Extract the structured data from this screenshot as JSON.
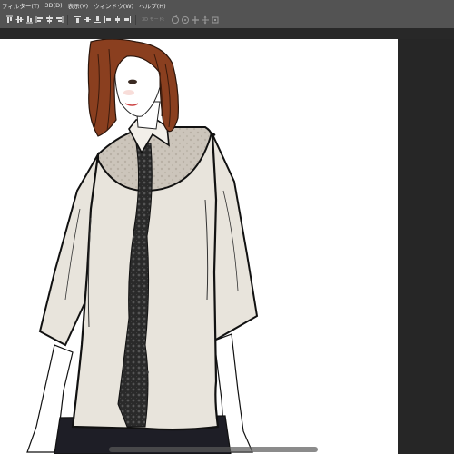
{
  "menu": [
    "フィルター(T)",
    "3D(D)",
    "表示(V)",
    "ウィンドウ(W)",
    "ヘルプ(H)"
  ],
  "options_bar": {
    "mode_3d_label": "3D モード:",
    "align_icons": [
      "align-top-edges-icon",
      "align-vertical-centers-icon",
      "align-bottom-edges-icon",
      "align-left-edges-icon",
      "align-horizontal-centers-icon",
      "align-right-edges-icon"
    ],
    "distribute_icons": [
      "distribute-top-icon",
      "distribute-vcenter-icon",
      "distribute-bottom-icon",
      "distribute-left-icon",
      "distribute-hcenter-icon",
      "distribute-right-icon"
    ],
    "mode_3d_icons": [
      "rotate-3d-icon",
      "roll-3d-icon",
      "drag-3d-icon",
      "slide-3d-icon",
      "scale-3d-icon"
    ]
  },
  "colors": {
    "ui_gray": "#535353",
    "panel_dark": "#282828",
    "canvas": "#ffffff",
    "shirt": "#e8e4dc",
    "yoke": "#c9c2b8",
    "hair": "#8a3f1f",
    "skirt": "#1e1e26",
    "lace": "#222222"
  }
}
